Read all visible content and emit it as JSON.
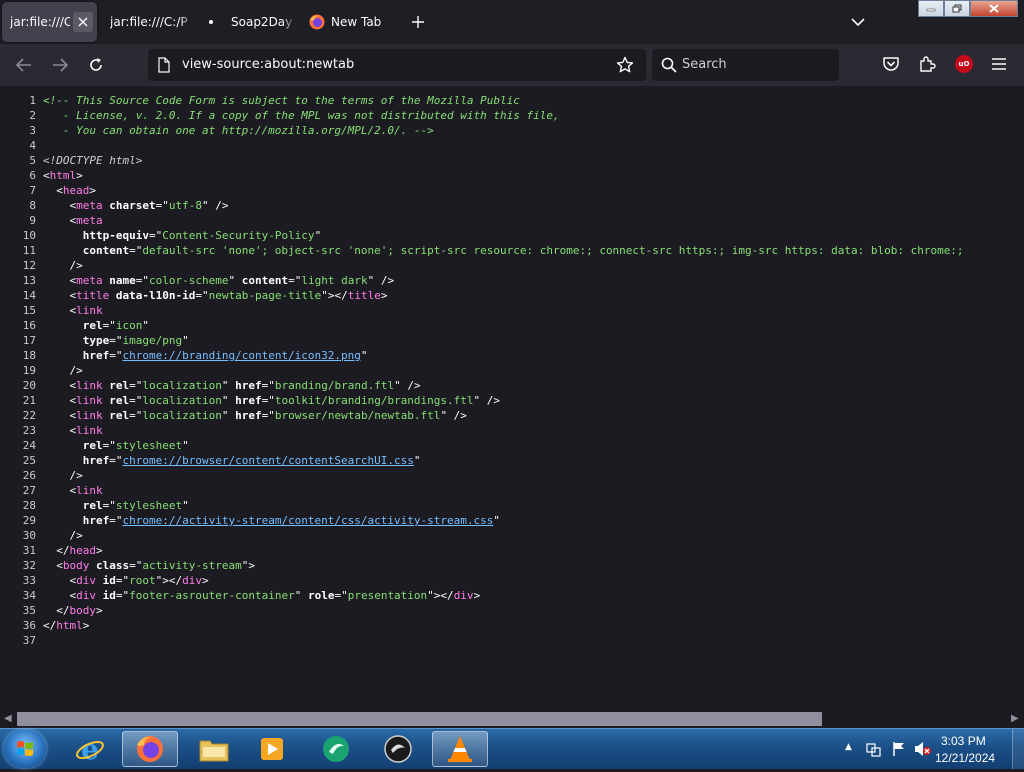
{
  "tabs": [
    {
      "label": "jar:file:///C",
      "active": true
    },
    {
      "label": "jar:file:///C:/P",
      "active": false
    },
    {
      "label": "Soap2Day",
      "active": false
    },
    {
      "label": "New Tab",
      "active": false
    }
  ],
  "navbar": {
    "url": "view-source:about:newtab",
    "search_placeholder": "Search",
    "extension_badge": "uO"
  },
  "source_lines": [
    {
      "n": "1",
      "parts": [
        [
          "comment",
          "<!-- This Source Code Form is subject to the terms of the Mozilla Public"
        ]
      ]
    },
    {
      "n": "2",
      "parts": [
        [
          "comment",
          "   - License, v. 2.0. If a copy of the MPL was not distributed with this file,"
        ]
      ]
    },
    {
      "n": "3",
      "parts": [
        [
          "comment",
          "   - You can obtain one at http://mozilla.org/MPL/2.0/. -->"
        ]
      ]
    },
    {
      "n": "4",
      "parts": []
    },
    {
      "n": "5",
      "parts": [
        [
          "doctype",
          "<!DOCTYPE html>"
        ]
      ]
    },
    {
      "n": "6",
      "parts": [
        [
          "punct",
          "<"
        ],
        [
          "tag",
          "html"
        ],
        [
          "punct",
          ">"
        ]
      ]
    },
    {
      "n": "7",
      "parts": [
        [
          "punct",
          "  <"
        ],
        [
          "tag",
          "head"
        ],
        [
          "punct",
          ">"
        ]
      ]
    },
    {
      "n": "8",
      "parts": [
        [
          "punct",
          "    <"
        ],
        [
          "tag",
          "meta"
        ],
        [
          "punct",
          " "
        ],
        [
          "attr",
          "charset"
        ],
        [
          "punct",
          "=\""
        ],
        [
          "val",
          "utf-8"
        ],
        [
          "punct",
          "\" />"
        ]
      ]
    },
    {
      "n": "9",
      "parts": [
        [
          "punct",
          "    <"
        ],
        [
          "tag",
          "meta"
        ]
      ]
    },
    {
      "n": "10",
      "parts": [
        [
          "punct",
          "      "
        ],
        [
          "attr",
          "http-equiv"
        ],
        [
          "punct",
          "=\""
        ],
        [
          "val",
          "Content-Security-Policy"
        ],
        [
          "punct",
          "\""
        ]
      ]
    },
    {
      "n": "11",
      "parts": [
        [
          "punct",
          "      "
        ],
        [
          "attr",
          "content"
        ],
        [
          "punct",
          "=\""
        ],
        [
          "val",
          "default-src 'none'; object-src 'none'; script-src resource: chrome:; connect-src https:; img-src https: data: blob: chrome:;"
        ]
      ]
    },
    {
      "n": "12",
      "parts": [
        [
          "punct",
          "    />"
        ]
      ]
    },
    {
      "n": "13",
      "parts": [
        [
          "punct",
          "    <"
        ],
        [
          "tag",
          "meta"
        ],
        [
          "punct",
          " "
        ],
        [
          "attr",
          "name"
        ],
        [
          "punct",
          "=\""
        ],
        [
          "val",
          "color-scheme"
        ],
        [
          "punct",
          "\" "
        ],
        [
          "attr",
          "content"
        ],
        [
          "punct",
          "=\""
        ],
        [
          "val",
          "light dark"
        ],
        [
          "punct",
          "\" />"
        ]
      ]
    },
    {
      "n": "14",
      "parts": [
        [
          "punct",
          "    <"
        ],
        [
          "tag",
          "title"
        ],
        [
          "punct",
          " "
        ],
        [
          "attr",
          "data-l10n-id"
        ],
        [
          "punct",
          "=\""
        ],
        [
          "val",
          "newtab-page-title"
        ],
        [
          "punct",
          "\"></"
        ],
        [
          "tag",
          "title"
        ],
        [
          "punct",
          ">"
        ]
      ]
    },
    {
      "n": "15",
      "parts": [
        [
          "punct",
          "    <"
        ],
        [
          "tag",
          "link"
        ]
      ]
    },
    {
      "n": "16",
      "parts": [
        [
          "punct",
          "      "
        ],
        [
          "attr",
          "rel"
        ],
        [
          "punct",
          "=\""
        ],
        [
          "val",
          "icon"
        ],
        [
          "punct",
          "\""
        ]
      ]
    },
    {
      "n": "17",
      "parts": [
        [
          "punct",
          "      "
        ],
        [
          "attr",
          "type"
        ],
        [
          "punct",
          "=\""
        ],
        [
          "val",
          "image/png"
        ],
        [
          "punct",
          "\""
        ]
      ]
    },
    {
      "n": "18",
      "parts": [
        [
          "punct",
          "      "
        ],
        [
          "attr",
          "href"
        ],
        [
          "punct",
          "=\""
        ],
        [
          "link",
          "chrome://branding/content/icon32.png"
        ],
        [
          "punct",
          "\""
        ]
      ]
    },
    {
      "n": "19",
      "parts": [
        [
          "punct",
          "    />"
        ]
      ]
    },
    {
      "n": "20",
      "parts": [
        [
          "punct",
          "    <"
        ],
        [
          "tag",
          "link"
        ],
        [
          "punct",
          " "
        ],
        [
          "attr",
          "rel"
        ],
        [
          "punct",
          "=\""
        ],
        [
          "val",
          "localization"
        ],
        [
          "punct",
          "\" "
        ],
        [
          "attr",
          "href"
        ],
        [
          "punct",
          "=\""
        ],
        [
          "val",
          "branding/brand.ftl"
        ],
        [
          "punct",
          "\" />"
        ]
      ]
    },
    {
      "n": "21",
      "parts": [
        [
          "punct",
          "    <"
        ],
        [
          "tag",
          "link"
        ],
        [
          "punct",
          " "
        ],
        [
          "attr",
          "rel"
        ],
        [
          "punct",
          "=\""
        ],
        [
          "val",
          "localization"
        ],
        [
          "punct",
          "\" "
        ],
        [
          "attr",
          "href"
        ],
        [
          "punct",
          "=\""
        ],
        [
          "val",
          "toolkit/branding/brandings.ftl"
        ],
        [
          "punct",
          "\" />"
        ]
      ]
    },
    {
      "n": "22",
      "parts": [
        [
          "punct",
          "    <"
        ],
        [
          "tag",
          "link"
        ],
        [
          "punct",
          " "
        ],
        [
          "attr",
          "rel"
        ],
        [
          "punct",
          "=\""
        ],
        [
          "val",
          "localization"
        ],
        [
          "punct",
          "\" "
        ],
        [
          "attr",
          "href"
        ],
        [
          "punct",
          "=\""
        ],
        [
          "val",
          "browser/newtab/newtab.ftl"
        ],
        [
          "punct",
          "\" />"
        ]
      ]
    },
    {
      "n": "23",
      "parts": [
        [
          "punct",
          "    <"
        ],
        [
          "tag",
          "link"
        ]
      ]
    },
    {
      "n": "24",
      "parts": [
        [
          "punct",
          "      "
        ],
        [
          "attr",
          "rel"
        ],
        [
          "punct",
          "=\""
        ],
        [
          "val",
          "stylesheet"
        ],
        [
          "punct",
          "\""
        ]
      ]
    },
    {
      "n": "25",
      "parts": [
        [
          "punct",
          "      "
        ],
        [
          "attr",
          "href"
        ],
        [
          "punct",
          "=\""
        ],
        [
          "link",
          "chrome://browser/content/contentSearchUI.css"
        ],
        [
          "punct",
          "\""
        ]
      ]
    },
    {
      "n": "26",
      "parts": [
        [
          "punct",
          "    />"
        ]
      ]
    },
    {
      "n": "27",
      "parts": [
        [
          "punct",
          "    <"
        ],
        [
          "tag",
          "link"
        ]
      ]
    },
    {
      "n": "28",
      "parts": [
        [
          "punct",
          "      "
        ],
        [
          "attr",
          "rel"
        ],
        [
          "punct",
          "=\""
        ],
        [
          "val",
          "stylesheet"
        ],
        [
          "punct",
          "\""
        ]
      ]
    },
    {
      "n": "29",
      "parts": [
        [
          "punct",
          "      "
        ],
        [
          "attr",
          "href"
        ],
        [
          "punct",
          "=\""
        ],
        [
          "link",
          "chrome://activity-stream/content/css/activity-stream.css"
        ],
        [
          "punct",
          "\""
        ]
      ]
    },
    {
      "n": "30",
      "parts": [
        [
          "punct",
          "    />"
        ]
      ]
    },
    {
      "n": "31",
      "parts": [
        [
          "punct",
          "  </"
        ],
        [
          "tag",
          "head"
        ],
        [
          "punct",
          ">"
        ]
      ]
    },
    {
      "n": "32",
      "parts": [
        [
          "punct",
          "  <"
        ],
        [
          "tag",
          "body"
        ],
        [
          "punct",
          " "
        ],
        [
          "attr",
          "class"
        ],
        [
          "punct",
          "=\""
        ],
        [
          "val",
          "activity-stream"
        ],
        [
          "punct",
          "\">"
        ]
      ]
    },
    {
      "n": "33",
      "parts": [
        [
          "punct",
          "    <"
        ],
        [
          "tag",
          "div"
        ],
        [
          "punct",
          " "
        ],
        [
          "attr",
          "id"
        ],
        [
          "punct",
          "=\""
        ],
        [
          "val",
          "root"
        ],
        [
          "punct",
          "\"></"
        ],
        [
          "tag",
          "div"
        ],
        [
          "punct",
          ">"
        ]
      ]
    },
    {
      "n": "34",
      "parts": [
        [
          "punct",
          "    <"
        ],
        [
          "tag",
          "div"
        ],
        [
          "punct",
          " "
        ],
        [
          "attr",
          "id"
        ],
        [
          "punct",
          "=\""
        ],
        [
          "val",
          "footer-asrouter-container"
        ],
        [
          "punct",
          "\" "
        ],
        [
          "attr",
          "role"
        ],
        [
          "punct",
          "=\""
        ],
        [
          "val",
          "presentation"
        ],
        [
          "punct",
          "\"></"
        ],
        [
          "tag",
          "div"
        ],
        [
          "punct",
          ">"
        ]
      ]
    },
    {
      "n": "35",
      "parts": [
        [
          "punct",
          "  </"
        ],
        [
          "tag",
          "body"
        ],
        [
          "punct",
          ">"
        ]
      ]
    },
    {
      "n": "36",
      "parts": [
        [
          "punct",
          "</"
        ],
        [
          "tag",
          "html"
        ],
        [
          "punct",
          ">"
        ]
      ]
    },
    {
      "n": "37",
      "parts": []
    }
  ],
  "taskbar": {
    "items": [
      "internet-explorer",
      "firefox",
      "file-explorer",
      "media-player",
      "messenger",
      "disk-burner",
      "vlc"
    ],
    "clock_time": "3:03 PM",
    "clock_date": "12/21/2024"
  },
  "colors": {
    "tag": "#ff7de9",
    "value": "#86de74",
    "link": "#75bfff",
    "background": "#1c1b22",
    "toolbar": "#2b2a33"
  }
}
